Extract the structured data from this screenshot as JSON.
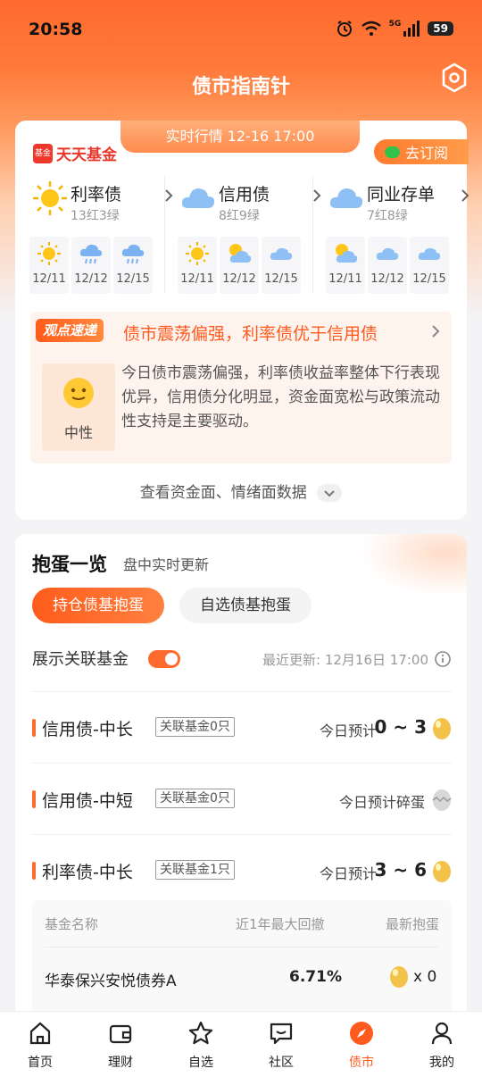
{
  "status_bar": {
    "time": "20:58",
    "network": "5G",
    "battery": "59"
  },
  "header": {
    "title": "债市指南针"
  },
  "market": {
    "realtime_label": "实时行情  12-16 17:00",
    "brand": "天天基金",
    "brand_icon_text": "基金",
    "subscribe_label": "去订阅",
    "categories": [
      {
        "name": "利率债",
        "count": "13红3绿",
        "icon": "sun-icon",
        "days": [
          {
            "date": "12/11",
            "icon": "sun-icon"
          },
          {
            "date": "12/12",
            "icon": "rain-cloud-icon"
          },
          {
            "date": "12/15",
            "icon": "rain-cloud-icon"
          }
        ]
      },
      {
        "name": "信用债",
        "count": "8红9绿",
        "icon": "cloud-icon",
        "days": [
          {
            "date": "12/11",
            "icon": "sun-icon"
          },
          {
            "date": "12/12",
            "icon": "partly-cloudy-icon"
          },
          {
            "date": "12/15",
            "icon": "cloud-icon"
          }
        ]
      },
      {
        "name": "同业存单",
        "count": "7红8绿",
        "icon": "cloud-icon",
        "days": [
          {
            "date": "12/11",
            "icon": "partly-cloudy-icon"
          },
          {
            "date": "12/12",
            "icon": "cloud-icon"
          },
          {
            "date": "12/15",
            "icon": "cloud-icon"
          }
        ]
      }
    ],
    "view": {
      "tag": "观点速递",
      "headline": "债市震荡偏强，利率债优于信用债",
      "sentiment": "中性",
      "body": "今日债市震荡偏强，利率债收益率整体下行表现优异，信用债分化明显，资金面宽松与政策流动性支持是主要驱动。"
    },
    "more_label": "查看资金面、情绪面数据"
  },
  "eggs": {
    "title": "抱蛋一览",
    "subtitle": "盘中实时更新",
    "tabs": [
      "持仓债基抱蛋",
      "自选债基抱蛋"
    ],
    "toggle_label": "展示关联基金",
    "toggle_on": true,
    "update_text": "最近更新:  12月16日 17:00",
    "rows": [
      {
        "name": "信用债-中长",
        "tag": "关联基金0只",
        "prefix": "今日预计",
        "range": "0 ~ 3",
        "egg": "golden-egg-icon"
      },
      {
        "name": "信用债-中短",
        "tag": "关联基金0只",
        "prefix": "今日预计碎蛋",
        "range": "",
        "egg": "broken-egg-icon"
      },
      {
        "name": "利率债-中长",
        "tag": "关联基金1只",
        "prefix": "今日预计",
        "range": "3 ~ 6",
        "egg": "golden-egg-icon"
      }
    ],
    "fund_table": {
      "headers": [
        "基金名称",
        "近1年最大回撤",
        "最新抱蛋"
      ],
      "rows": [
        {
          "name": "华泰保兴安悦债券A",
          "drawdown": "6.71%",
          "eggs": "x 0"
        }
      ]
    }
  },
  "tab_bar": {
    "items": [
      {
        "label": "首页",
        "icon": "home-icon"
      },
      {
        "label": "理财",
        "icon": "wallet-icon"
      },
      {
        "label": "自选",
        "icon": "star-icon"
      },
      {
        "label": "社区",
        "icon": "chat-icon"
      },
      {
        "label": "债市",
        "icon": "compass-icon"
      },
      {
        "label": "我的",
        "icon": "person-icon"
      }
    ],
    "active_index": 4
  },
  "colors": {
    "accent": "#ff6a2e",
    "accent_dark": "#ff5a1e",
    "egg_gold": "#f2c24a"
  }
}
